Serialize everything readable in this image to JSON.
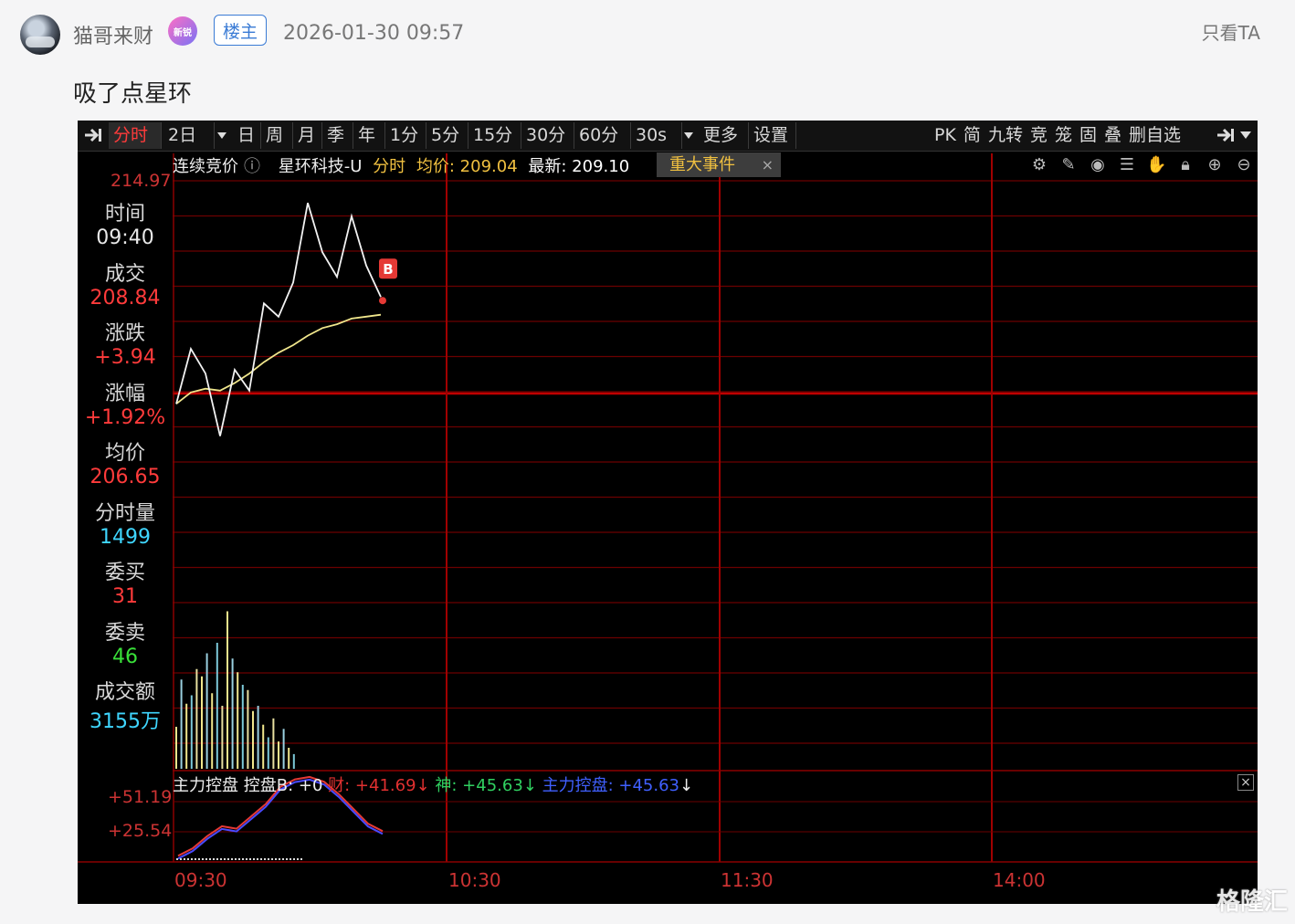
{
  "post": {
    "username": "猫哥来财",
    "new_badge": "新锐",
    "owner_tag": "楼主",
    "timestamp": "2026-01-30 09:57",
    "only_ta": "只看TA",
    "text": "吸了点星环"
  },
  "terminal": {
    "toolbar": {
      "tabs": [
        "分时",
        "2日",
        "日",
        "周",
        "月",
        "季",
        "年",
        "1分",
        "5分",
        "15分",
        "30分",
        "60分",
        "30s",
        "更多",
        "设置"
      ],
      "active": "分时",
      "right": [
        "PK",
        "简",
        "九转",
        "竞",
        "笼",
        "固",
        "叠",
        "删自选"
      ]
    },
    "info": {
      "mode": "连续竞价",
      "stock": "星环科技-U",
      "chart_kind": "分时",
      "avg_label": "均价: 209.04",
      "latest_label": "最新: 209.10",
      "event_tag": "重大事件",
      "event_close": "×"
    },
    "tool_icons": [
      "gear-icon",
      "pen-icon",
      "eye-icon",
      "layers-icon",
      "hand-icon",
      "lock-icon",
      "zoom-in-icon",
      "zoom-out-icon"
    ],
    "top_price": "214.97",
    "panel": [
      {
        "label": "时间",
        "value": "09:40",
        "value_color": "#e8e8e8"
      },
      {
        "label": "成交",
        "value": "208.84",
        "value_color": "#ff3b3b"
      },
      {
        "label": "涨跌",
        "value": "+3.94",
        "value_color": "#ff3b3b"
      },
      {
        "label": "涨幅",
        "value": "+1.92%",
        "value_color": "#ff3b3b"
      },
      {
        "label": "均价",
        "value": "206.65",
        "value_color": "#ff3b3b"
      },
      {
        "label": "分时量",
        "value": "1499",
        "value_color": "#3fd6ff"
      },
      {
        "label": "委买",
        "value": "31",
        "value_color": "#ff3b3b"
      },
      {
        "label": "委卖",
        "value": "46",
        "value_color": "#39e039"
      },
      {
        "label": "成交额",
        "value": "3155万",
        "value_color": "#3fd6ff"
      }
    ],
    "buy_marker": "B",
    "sub_indicator": {
      "title": "主力控盘",
      "ctrl": "控盘B: +0",
      "cai": "财: +41.69",
      "shen": "神: +45.63",
      "zhuli": "主力控盘: +45.63",
      "close": "×",
      "axis": [
        "+51.19",
        "+25.54"
      ]
    },
    "time_axis": [
      "09:30",
      "10:30",
      "11:30",
      "14:00"
    ],
    "watermark": "格隆汇"
  },
  "chart_data": {
    "type": "line",
    "title": "星环科技-U 分时",
    "series": [
      {
        "name": "价格",
        "values": [
          203.2,
          206.1,
          204.8,
          201.5,
          205.0,
          203.9,
          208.5,
          207.8,
          209.6,
          213.8,
          211.2,
          209.9,
          213.1,
          210.5,
          208.84
        ]
      },
      {
        "name": "均价",
        "values": [
          203.2,
          203.8,
          204.0,
          203.9,
          204.3,
          204.8,
          205.4,
          205.9,
          206.3,
          206.8,
          207.2,
          207.4,
          207.7,
          207.8,
          207.9
        ]
      }
    ],
    "volume": [
      40,
      85,
      62,
      70,
      95,
      88,
      110,
      72,
      120,
      60,
      150,
      105,
      92,
      80,
      75,
      55,
      60,
      42,
      30,
      48,
      26,
      38,
      20,
      14
    ],
    "x": [
      "09:30",
      "10:30",
      "11:30",
      "14:00"
    ]
  }
}
